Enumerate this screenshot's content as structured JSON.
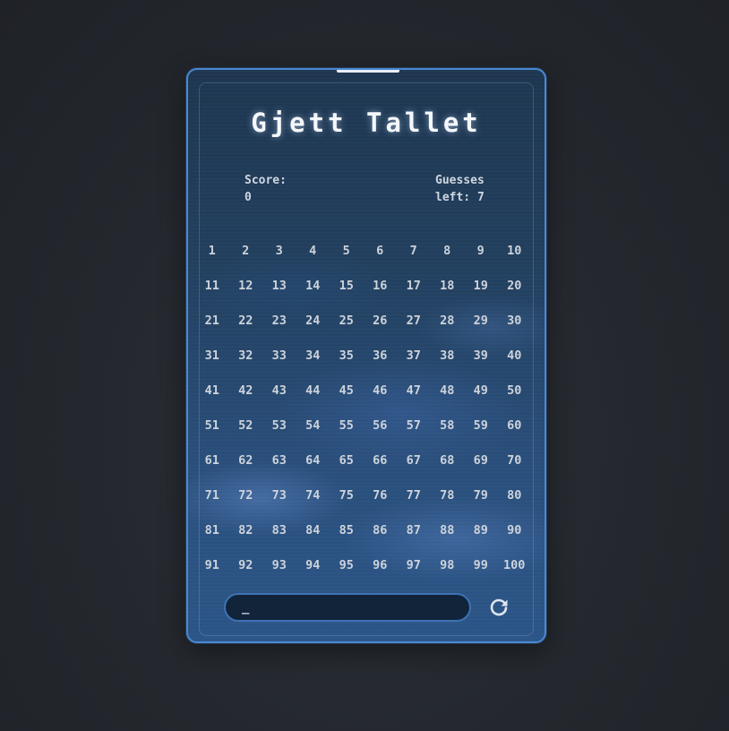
{
  "game": {
    "title": "Gjett Tallet",
    "score_label": "Score:",
    "score_value": "0",
    "guesses_label": "Guesses left:",
    "guesses_value": "7",
    "input_value": "_",
    "reset_icon": "refresh-icon"
  },
  "numbers": [
    "1",
    "2",
    "3",
    "4",
    "5",
    "6",
    "7",
    "8",
    "9",
    "10",
    "11",
    "12",
    "13",
    "14",
    "15",
    "16",
    "17",
    "18",
    "19",
    "20",
    "21",
    "22",
    "23",
    "24",
    "25",
    "26",
    "27",
    "28",
    "29",
    "30",
    "31",
    "32",
    "33",
    "34",
    "35",
    "36",
    "37",
    "38",
    "39",
    "40",
    "41",
    "42",
    "43",
    "44",
    "45",
    "46",
    "47",
    "48",
    "49",
    "50",
    "51",
    "52",
    "53",
    "54",
    "55",
    "56",
    "57",
    "58",
    "59",
    "60",
    "61",
    "62",
    "63",
    "64",
    "65",
    "66",
    "67",
    "68",
    "69",
    "70",
    "71",
    "72",
    "73",
    "74",
    "75",
    "76",
    "77",
    "78",
    "79",
    "80",
    "81",
    "82",
    "83",
    "84",
    "85",
    "86",
    "87",
    "88",
    "89",
    "90",
    "91",
    "92",
    "93",
    "94",
    "95",
    "96",
    "97",
    "98",
    "99",
    "100"
  ],
  "colors": {
    "accent": "#4a88d4",
    "background": "#24282e",
    "text": "#cdd3db"
  }
}
